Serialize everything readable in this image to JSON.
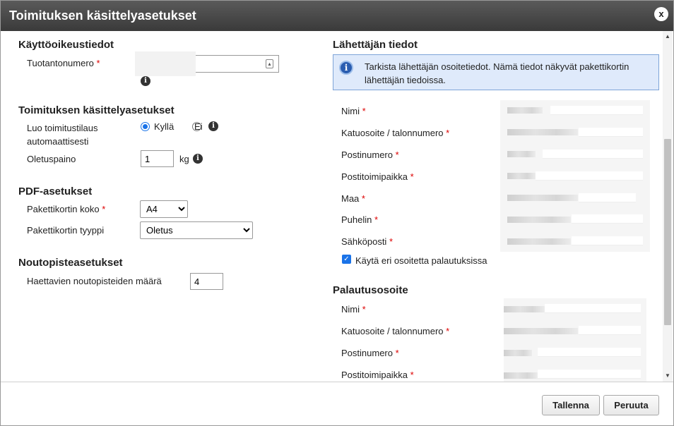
{
  "dialog": {
    "title": "Toimituksen käsittelyasetukset",
    "close_label": "x"
  },
  "access": {
    "heading": "Käyttöoikeustiedot",
    "production_number_label": "Tuotantonumero",
    "required_mark": "*"
  },
  "handling": {
    "heading": "Toimituksen käsittelyasetukset",
    "auto_order_label_line1": "Luo toimitustilaus",
    "auto_order_label_line2": "automaattisesti",
    "yes_label": "Kyllä",
    "no_label": "Ei",
    "default_weight_label": "Oletuspaino",
    "default_weight_value": "1",
    "weight_unit": "kg"
  },
  "pdf": {
    "heading": "PDF-asetukset",
    "card_size_label": "Pakettikortin koko",
    "card_size_value": "A4",
    "card_type_label": "Pakettikortin tyyppi",
    "card_type_value": "Oletus"
  },
  "pickup": {
    "heading": "Noutopisteasetukset",
    "count_label": "Haettavien noutopisteiden määrä",
    "count_value": "4"
  },
  "sender": {
    "heading": "Lähettäjän tiedot",
    "notice": "Tarkista lähettäjän osoitetiedot. Nämä tiedot näkyvät pakettikortin lähettäjän tiedoissa.",
    "fields": {
      "name": "Nimi",
      "street": "Katuosoite / talonnumero",
      "postal_code": "Postinumero",
      "city": "Postitoimipaikka",
      "country": "Maa",
      "phone": "Puhelin",
      "email": "Sähköposti"
    },
    "use_other_address_label": "Käytä eri osoitetta palautuksissa"
  },
  "returns": {
    "heading": "Palautusosoite",
    "fields": {
      "name": "Nimi",
      "street": "Katuosoite / talonnumero",
      "postal_code": "Postinumero",
      "city": "Postitoimipaikka"
    }
  },
  "footer": {
    "save_label": "Tallenna",
    "cancel_label": "Peruuta"
  },
  "icons": {
    "info": "info-icon",
    "close": "close-icon",
    "contact-card": "contact-card-icon"
  },
  "colors": {
    "titlebar": "#4a4a4a",
    "accent": "#1a73e8",
    "notice_bg": "#dfeafb",
    "required": "#dd0000"
  }
}
